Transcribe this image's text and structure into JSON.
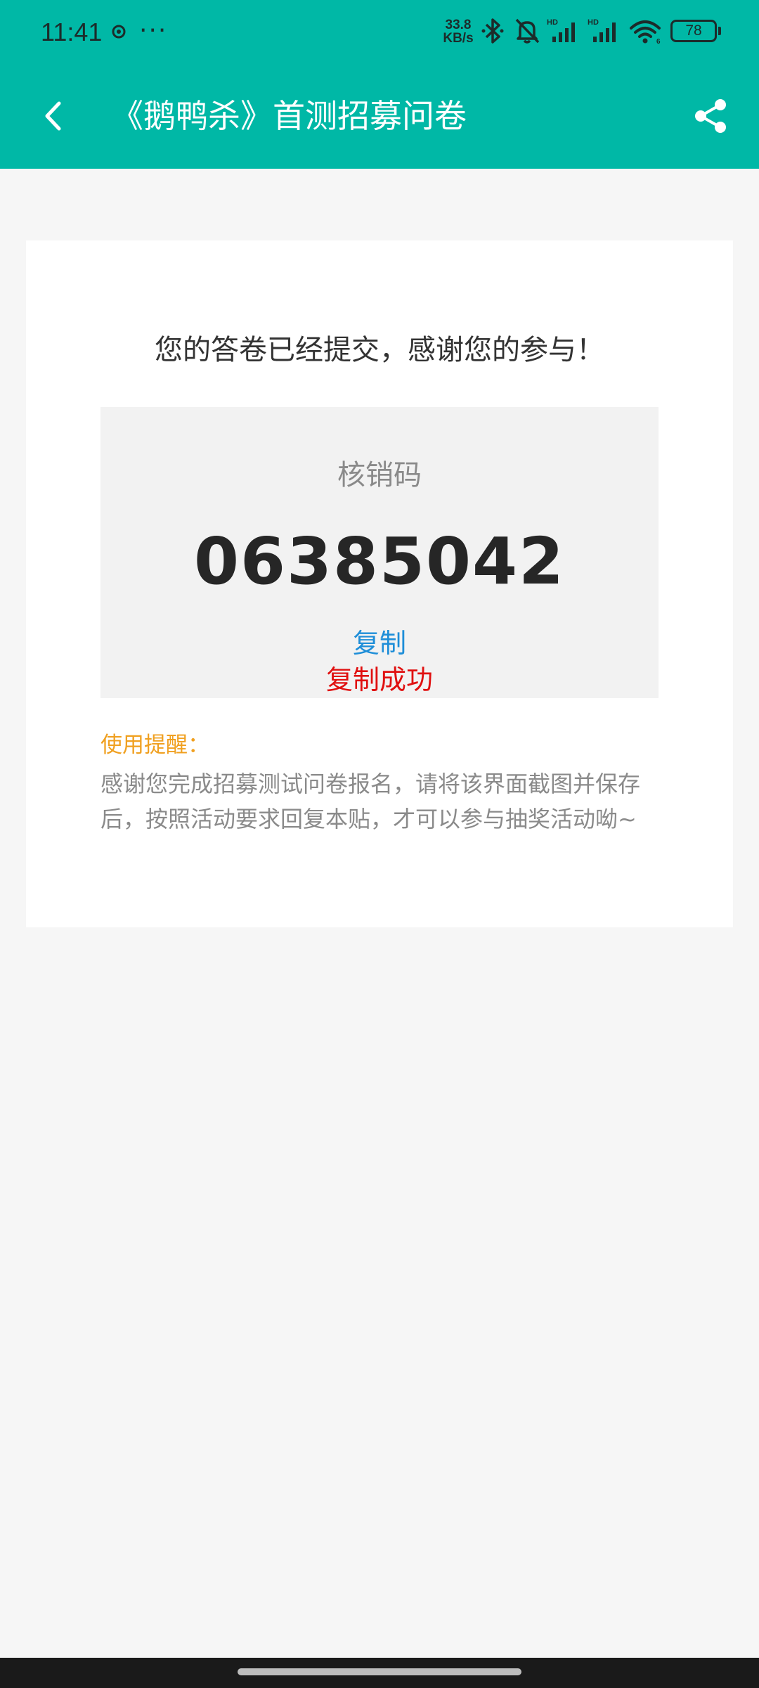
{
  "status_bar": {
    "time": "11:41",
    "dots": "···",
    "network_speed_value": "33.8",
    "network_speed_unit": "KB/s",
    "battery": "78"
  },
  "header": {
    "title": "《鹅鸭杀》首测招募问卷"
  },
  "card": {
    "thanks_message": "您的答卷已经提交，感谢您的参与！",
    "code_label": "核销码",
    "code_value": "06385042",
    "copy_label": "复制",
    "copy_success": "复制成功",
    "reminder_title": "使用提醒：",
    "reminder_body": "感谢您完成招募测试问卷报名，请将该界面截图并保存后，按照活动要求回复本贴，才可以参与抽奖活动呦~"
  },
  "colors": {
    "header_bg": "#00b8a6",
    "copy_link": "#1e8ed8",
    "copy_success": "#e01010",
    "reminder_title": "#f0a020"
  },
  "icons": {
    "back": "chevron-left-icon",
    "share": "share-icon",
    "bluetooth": "bluetooth-icon",
    "mute": "bell-off-icon",
    "signal": "signal-icon",
    "wifi": "wifi-icon"
  }
}
